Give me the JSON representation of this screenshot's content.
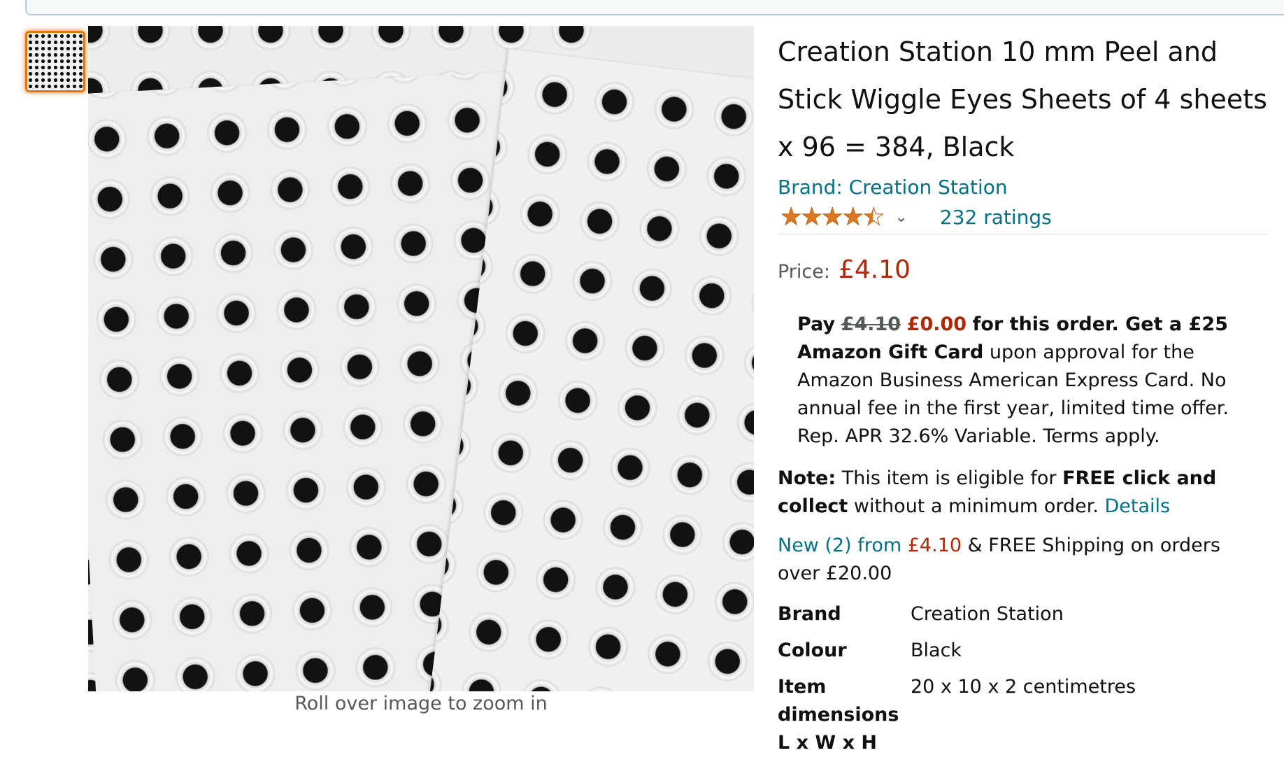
{
  "product": {
    "title": "Creation Station 10 mm Peel and Stick Wiggle Eyes Sheets of 4 sheets x 96 = 384, Black",
    "brand_link": "Brand: Creation Station",
    "rating": {
      "stars": 4.5,
      "max": 5,
      "ratings_text": "232 ratings",
      "chevron_icon": "chevron-down-icon"
    },
    "price_label": "Price:",
    "price": "£4.10"
  },
  "gallery": {
    "zoom_caption": "Roll over image to zoom in",
    "thumbnail_border_color": "#e77600"
  },
  "offer": {
    "pay": "Pay",
    "old_price": "£4.10",
    "new_price": "£0.00",
    "bold_text": "for this order. Get a £25 Amazon Gift Card",
    "rest_text": "upon approval for the Amazon Business American Express Card. No annual fee in the first year, limited time offer. Rep. APR 32.6% Variable. Terms apply."
  },
  "note": {
    "label": "Note:",
    "text1": "This item is eligible for",
    "bold": "FREE click and collect",
    "text2": "without a minimum order.",
    "details_link": "Details"
  },
  "new_from": {
    "link": "New (2) from",
    "price": "£4.10",
    "text": "& FREE Shipping on orders over £20.00"
  },
  "specs": [
    {
      "key": "Brand",
      "value": "Creation Station"
    },
    {
      "key": "Colour",
      "value": "Black"
    },
    {
      "key": "Item dimensions L x W x H",
      "value": "20 x 10 x 2 centimetres"
    }
  ],
  "colors": {
    "link": "#007185",
    "price": "#b12704",
    "star": "#de7921"
  }
}
